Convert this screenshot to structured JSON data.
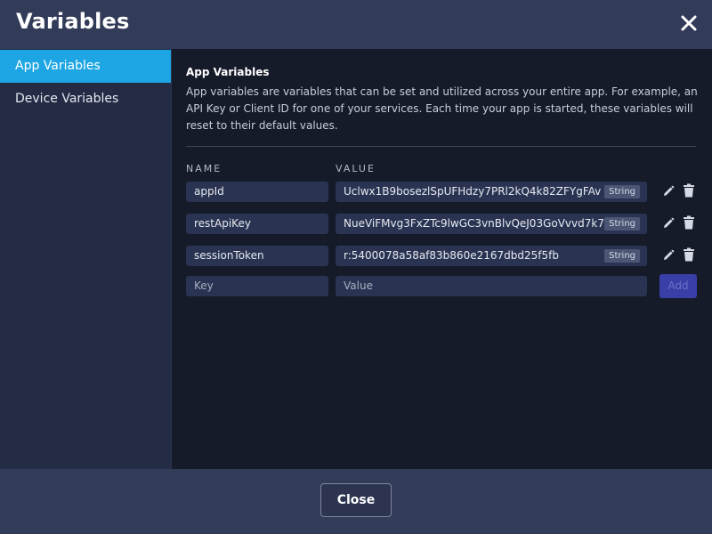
{
  "dialog": {
    "title": "Variables",
    "close_icon": "close-icon"
  },
  "sidebar": {
    "items": [
      {
        "label": "App Variables",
        "active": true
      },
      {
        "label": "Device Variables",
        "active": false
      }
    ]
  },
  "main": {
    "section_title": "App Variables",
    "description": "App variables are variables that can be set and utilized across your entire app. For example, an API Key or Client ID for one of your services. Each time your app is started, these variables will reset to their default values.",
    "columns": {
      "name": "NAME",
      "value": "VALUE"
    },
    "variables": [
      {
        "key": "appId",
        "value": "Uclwx1B9bosezlSpUFHdzy7PRl2kQ4k82ZFYgFAv",
        "type": "String"
      },
      {
        "key": "restApiKey",
        "value": "NueViFMvg3FxZTc9lwGC3vnBlvQeJ03GoVvvd7k7",
        "type": "String"
      },
      {
        "key": "sessionToken",
        "value": "r:5400078a58af83b860e2167dbd25f5fb",
        "type": "String"
      }
    ],
    "new_row": {
      "key_placeholder": "Key",
      "value_placeholder": "Value",
      "add_label": "Add"
    }
  },
  "footer": {
    "close_label": "Close"
  },
  "colors": {
    "accent": "#1da6e3",
    "header_bg": "#323b58",
    "panel_bg": "#161b2a",
    "sidebar_bg": "#232b45",
    "field_bg": "#2a3452",
    "add_button_bg": "#3a3fa8"
  }
}
